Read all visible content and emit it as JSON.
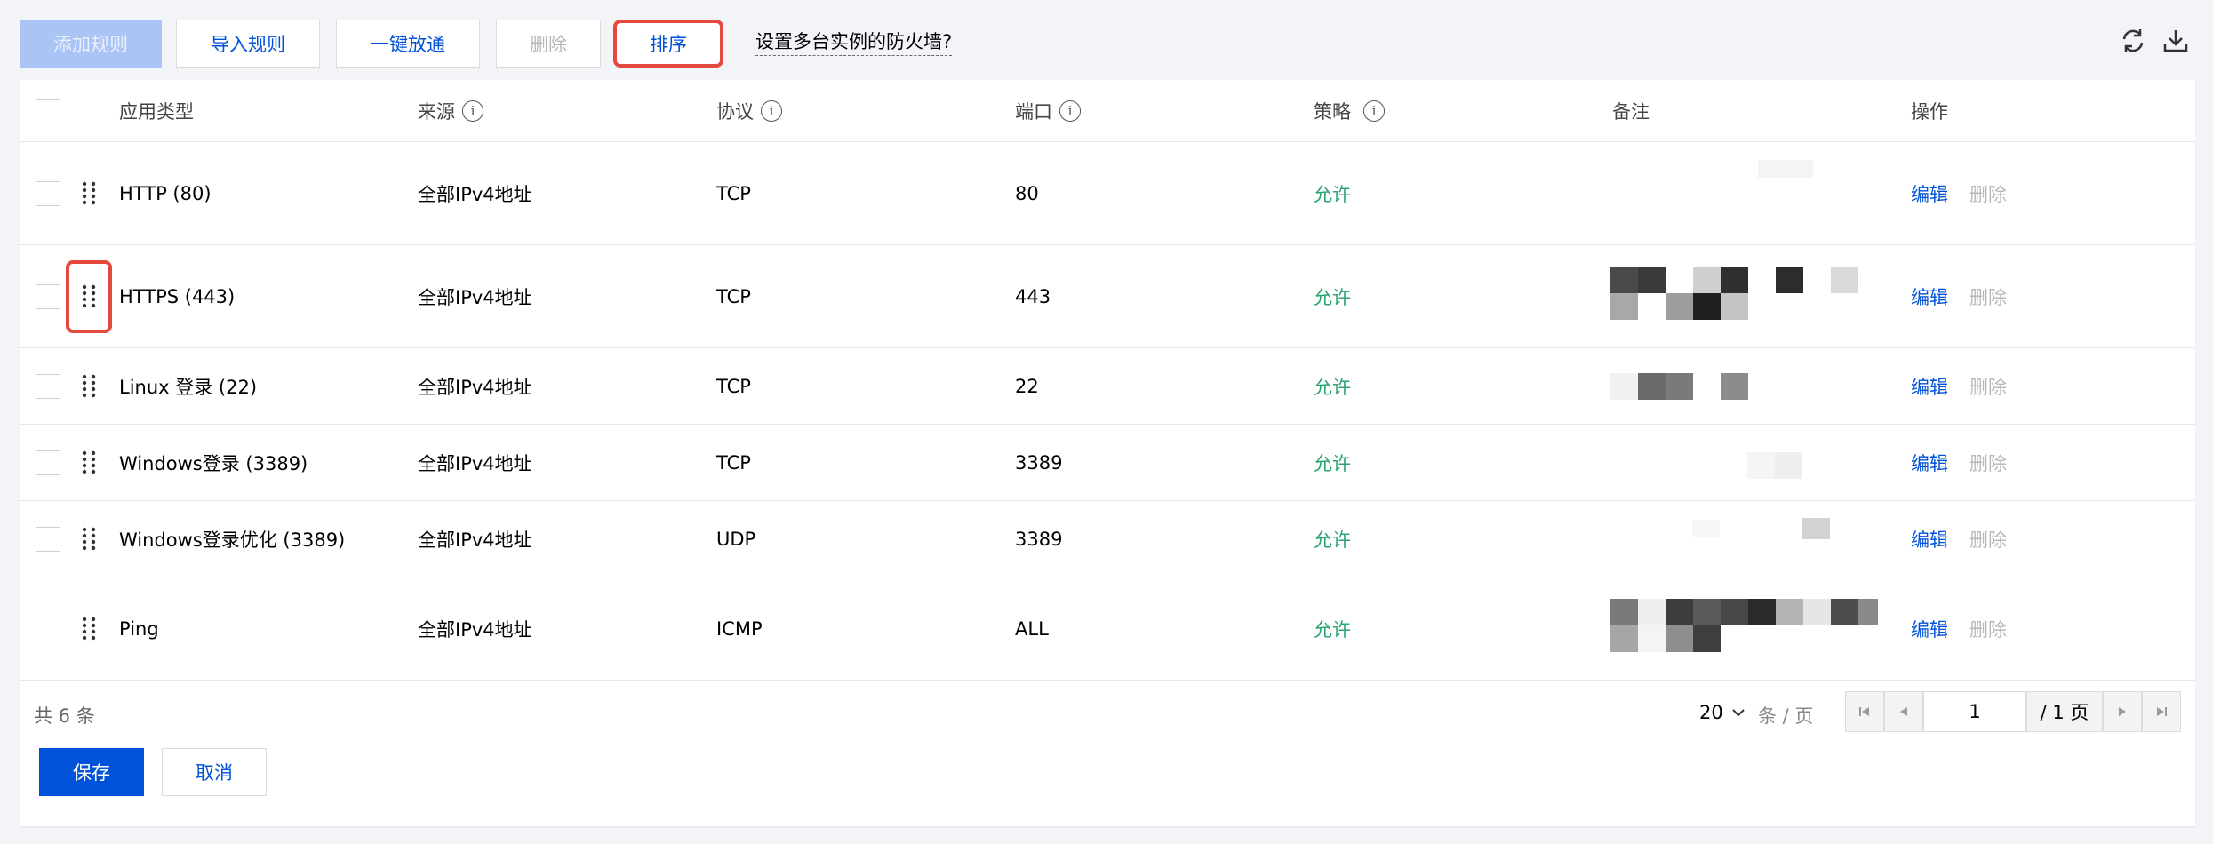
{
  "toolbar": {
    "add_rule": "添加规则",
    "import_rules": "导入规则",
    "one_click_allow": "一键放通",
    "delete": "删除",
    "sort": "排序",
    "help_link": "设置多台实例的防火墙?",
    "refresh_icon": "refresh-icon",
    "download_icon": "download-icon"
  },
  "table": {
    "headers": {
      "app_type": "应用类型",
      "source": "来源",
      "protocol": "协议",
      "port": "端口",
      "policy": "策略",
      "remark": "备注",
      "actions": "操作"
    },
    "rows": [
      {
        "app": "HTTP (80)",
        "source": "全部IPv4地址",
        "protocol": "TCP",
        "port": "80",
        "policy": "允许",
        "edit": "编辑",
        "delete": "删除"
      },
      {
        "app": "HTTPS (443)",
        "source": "全部IPv4地址",
        "protocol": "TCP",
        "port": "443",
        "policy": "允许",
        "edit": "编辑",
        "delete": "删除"
      },
      {
        "app": "Linux 登录 (22)",
        "source": "全部IPv4地址",
        "protocol": "TCP",
        "port": "22",
        "policy": "允许",
        "edit": "编辑",
        "delete": "删除"
      },
      {
        "app": "Windows登录 (3389)",
        "source": "全部IPv4地址",
        "protocol": "TCP",
        "port": "3389",
        "policy": "允许",
        "edit": "编辑",
        "delete": "删除"
      },
      {
        "app": "Windows登录优化 (3389)",
        "source": "全部IPv4地址",
        "protocol": "UDP",
        "port": "3389",
        "policy": "允许",
        "edit": "编辑",
        "delete": "删除"
      },
      {
        "app": "Ping",
        "source": "全部IPv4地址",
        "protocol": "ICMP",
        "port": "ALL",
        "policy": "允许",
        "edit": "编辑",
        "delete": "删除"
      }
    ]
  },
  "footer": {
    "total": "共 6 条",
    "page_size": "20",
    "page_unit": "条 / 页",
    "current_page": "1",
    "total_pages": "/ 1 页",
    "save": "保存",
    "cancel": "取消"
  },
  "colors": {
    "accent": "#0052d9",
    "allow": "#2ba471",
    "highlight": "#e5483c"
  }
}
